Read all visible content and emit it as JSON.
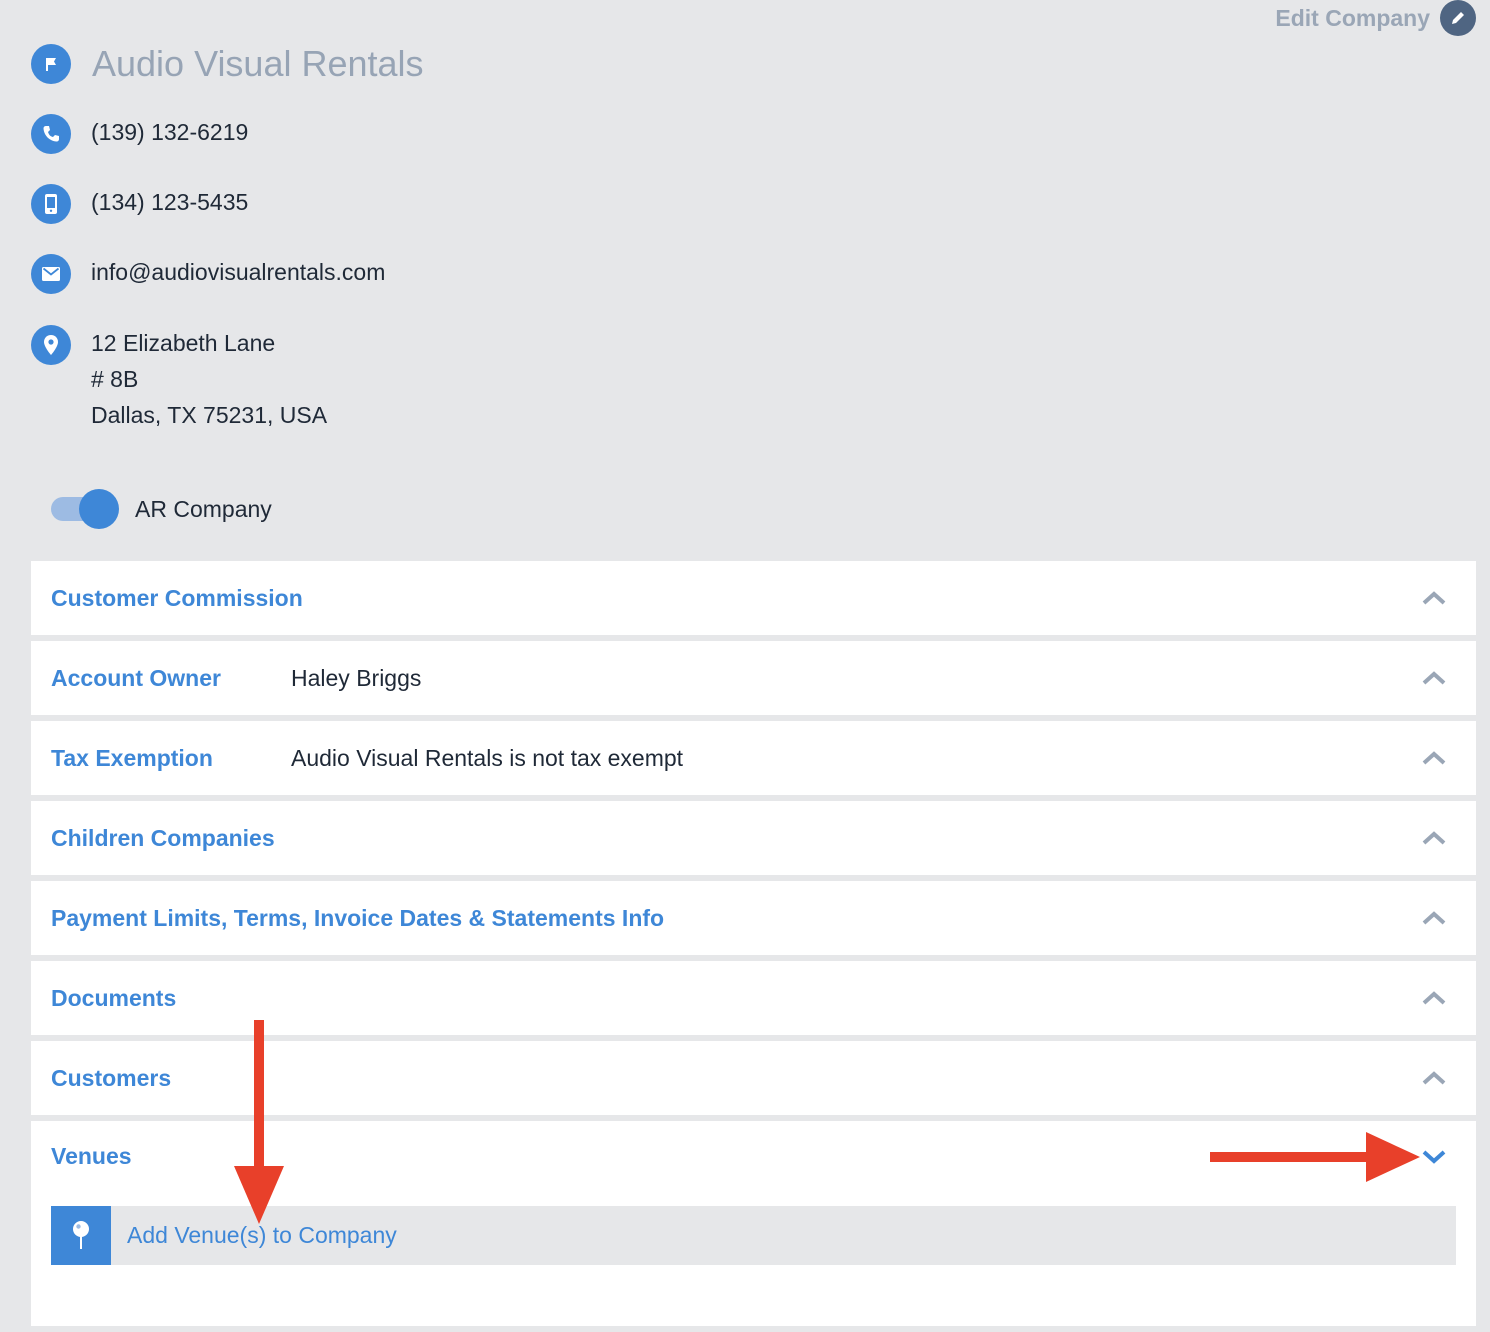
{
  "header": {
    "edit_company_label": "Edit Company",
    "company_name": "Audio Visual Rentals"
  },
  "contact": {
    "phone": "(139) 132-6219",
    "mobile": "(134) 123-5435",
    "email": "info@audiovisualrentals.com",
    "address_line1": "12 Elizabeth Lane",
    "address_line2": "# 8B",
    "address_line3": "Dallas, TX 75231, USA"
  },
  "ar_company": {
    "label": "AR Company",
    "enabled": true
  },
  "panels": [
    {
      "title": "Customer Commission",
      "value": ""
    },
    {
      "title": "Account Owner",
      "value": "Haley Briggs"
    },
    {
      "title": "Tax Exemption",
      "value": "Audio Visual Rentals is not tax exempt"
    },
    {
      "title": "Children Companies",
      "value": ""
    },
    {
      "title": "Payment Limits, Terms, Invoice Dates & Statements Info",
      "value": ""
    },
    {
      "title": "Documents",
      "value": ""
    },
    {
      "title": "Customers",
      "value": ""
    }
  ],
  "venues": {
    "title": "Venues",
    "add_label": "Add Venue(s) to Company"
  },
  "colors": {
    "accent": "#3e87d7",
    "background": "#e6e7e9",
    "annotation": "#e8402a"
  }
}
